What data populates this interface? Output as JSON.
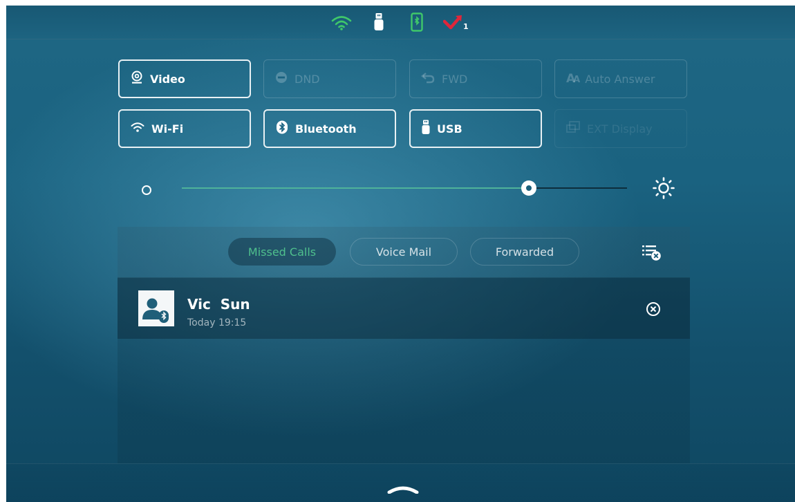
{
  "status_bar": {
    "icons": [
      "wifi-icon",
      "usb-icon",
      "bluetooth-phone-icon",
      "missed-call-icon"
    ],
    "missed_call_count": "1",
    "colors": {
      "wifi": "#3fc86a",
      "usb": "#ffffff",
      "bluetooth_phone": "#3fc86a",
      "missed_call": "#e0263a"
    }
  },
  "quick_toggles": [
    {
      "label": "Video",
      "icon": "camera-icon",
      "state": "enabled"
    },
    {
      "label": "DND",
      "icon": "dnd-icon",
      "state": "disabled"
    },
    {
      "label": "FWD",
      "icon": "forward-icon",
      "state": "disabled"
    },
    {
      "label": "Auto Answer",
      "icon": "auto-answer-icon",
      "state": "disabled"
    },
    {
      "label": "Wi-Fi",
      "icon": "wifi-icon",
      "state": "enabled"
    },
    {
      "label": "Bluetooth",
      "icon": "bluetooth-icon",
      "state": "enabled"
    },
    {
      "label": "USB",
      "icon": "usb-icon",
      "state": "enabled"
    },
    {
      "label": "EXT Display",
      "icon": "ext-display-icon",
      "state": "unavailable"
    }
  ],
  "brightness": {
    "level": 0.78,
    "min_icon": "brightness-low-icon",
    "max_icon": "brightness-high-icon",
    "fill_color": "#4fb39a"
  },
  "notifications": {
    "tabs": [
      {
        "label": "Missed Calls",
        "active": true
      },
      {
        "label": "Voice Mail",
        "active": false
      },
      {
        "label": "Forwarded",
        "active": false
      }
    ],
    "active_color": "#4fc08d",
    "clear_all_icon": "clear-all-icon",
    "entries": [
      {
        "name": "Vic  Sun",
        "time": "Today 19:15",
        "avatar_icon": "bluetooth-contact-icon",
        "delete_icon": "delete-icon"
      }
    ]
  },
  "bottom_bar": {
    "handle_icon": "chevron-up-icon"
  }
}
